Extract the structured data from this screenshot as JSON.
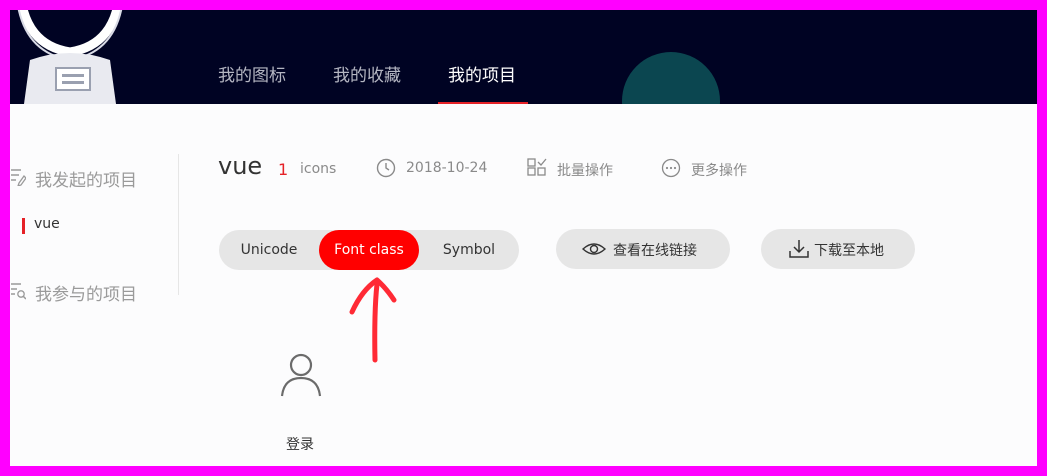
{
  "nav": {
    "items": [
      {
        "label": "我的图标"
      },
      {
        "label": "我的收藏"
      },
      {
        "label": "我的项目"
      }
    ],
    "active_index": 2
  },
  "sidebar": {
    "created_group": "我发起的项目",
    "created_items": [
      {
        "label": "vue"
      }
    ],
    "joined_group": "我参与的项目"
  },
  "project": {
    "name": "vue",
    "icon_count": "1",
    "icon_count_unit": "icons",
    "date": "2018-10-24",
    "batch_label": "批量操作",
    "more_label": "更多操作"
  },
  "format_tabs": {
    "items": [
      {
        "label": "Unicode"
      },
      {
        "label": "Font class"
      },
      {
        "label": "Symbol"
      }
    ],
    "active_index": 1
  },
  "actions": {
    "view_online_link": "查看在线链接",
    "download_local": "下载至本地"
  },
  "icons": [
    {
      "name": "登录",
      "code": "",
      "icon": "user-icon"
    }
  ],
  "colors": {
    "header_bg": "#000323",
    "accent_red": "#e52127",
    "active_tab": "#ff0000",
    "frame_border": "#ff00ff"
  }
}
